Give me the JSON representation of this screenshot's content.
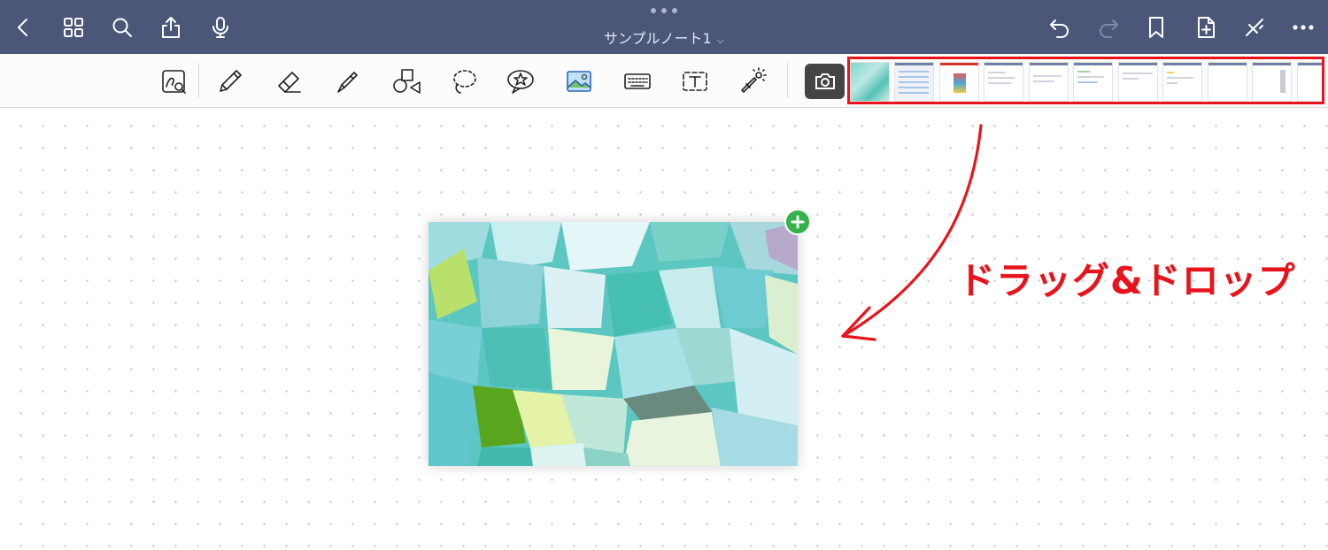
{
  "header": {
    "document_title": "サンプルノート1",
    "icons": [
      "back-icon",
      "grid-icon",
      "search-icon",
      "share-icon",
      "microphone-icon",
      "undo-icon",
      "redo-icon",
      "bookmark-icon",
      "add-page-icon",
      "close-drawing-icon",
      "more-icon"
    ]
  },
  "toolbar": {
    "tools": [
      "lasso-zoom-icon",
      "pen-icon",
      "eraser-icon",
      "highlighter-icon",
      "shapes-icon",
      "lasso-icon",
      "sticker-icon",
      "image-icon",
      "keyboard-icon",
      "text-box-icon",
      "laser-pointer-icon"
    ],
    "camera_icon": "camera-icon",
    "thumbnail_count": 11
  },
  "annotation": {
    "text": "ドラッグ&ドロップ",
    "color": "#e8141c"
  },
  "colors": {
    "navbar": "#4a5779",
    "highlight": "#e8141c",
    "add_badge": "#34b24a"
  }
}
